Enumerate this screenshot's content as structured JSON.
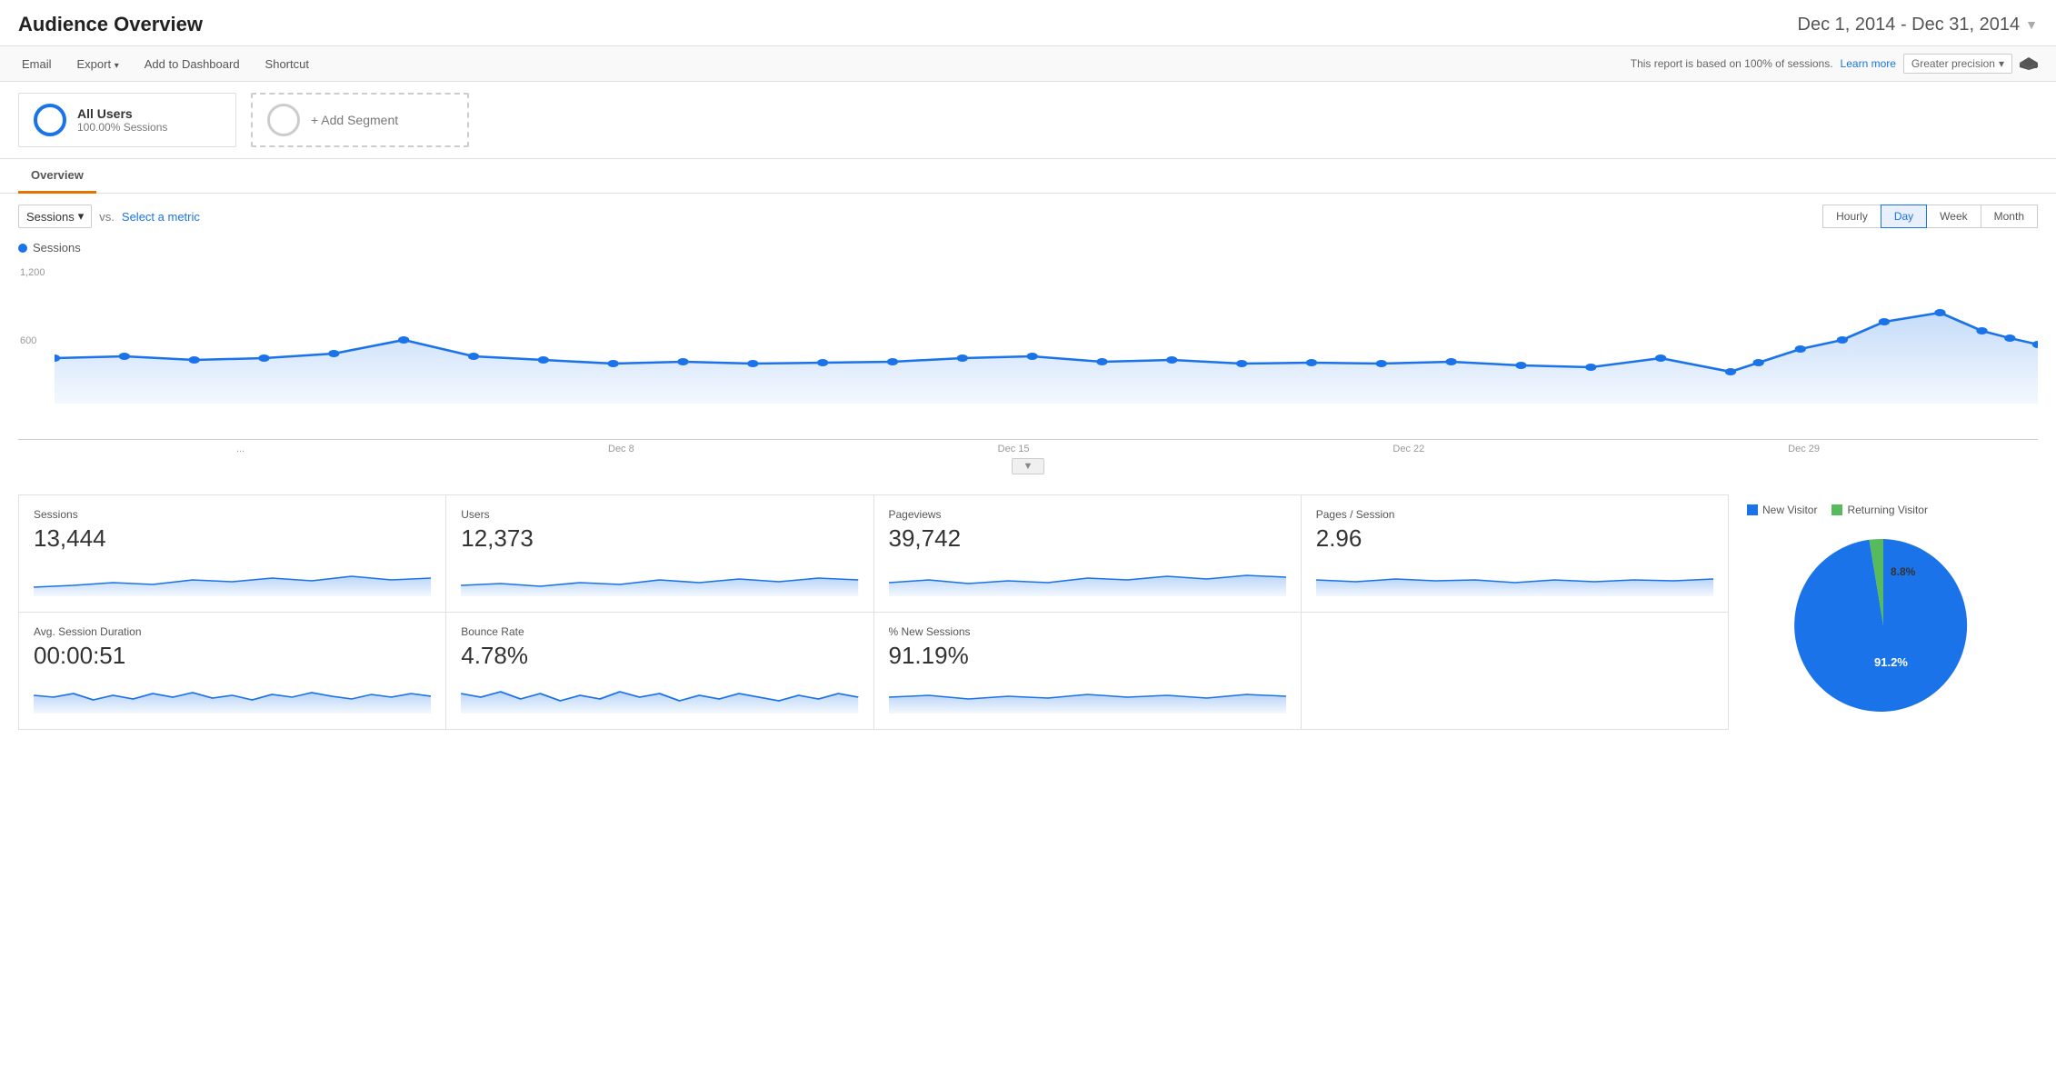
{
  "header": {
    "title": "Audience Overview",
    "date_range": "Dec 1, 2014 - Dec 31, 2014"
  },
  "toolbar": {
    "email": "Email",
    "export": "Export",
    "add_dashboard": "Add to Dashboard",
    "shortcut": "Shortcut",
    "report_info": "This report is based on 100% of sessions.",
    "learn_more": "Learn more",
    "precision": "Greater precision"
  },
  "segments": {
    "all_users": {
      "name": "All Users",
      "sub": "100.00% Sessions"
    },
    "add": "+ Add Segment"
  },
  "overview_tab": "Overview",
  "chart_controls": {
    "metric": "Sessions",
    "vs": "vs.",
    "select_metric": "Select a metric",
    "time_buttons": [
      "Hourly",
      "Day",
      "Week",
      "Month"
    ],
    "active_time": "Day"
  },
  "chart": {
    "legend": "Sessions",
    "y_labels": [
      "1,200",
      "600"
    ],
    "x_labels": [
      "...",
      "Dec 8",
      "Dec 15",
      "Dec 22",
      "Dec 29"
    ]
  },
  "metrics": [
    {
      "label": "Sessions",
      "value": "13,444"
    },
    {
      "label": "Users",
      "value": "12,373"
    },
    {
      "label": "Pageviews",
      "value": "39,742"
    },
    {
      "label": "Pages / Session",
      "value": "2.96"
    },
    {
      "label": "Avg. Session Duration",
      "value": "00:00:51"
    },
    {
      "label": "Bounce Rate",
      "value": "4.78%"
    },
    {
      "label": "% New Sessions",
      "value": "91.19%"
    }
  ],
  "pie": {
    "legend": [
      {
        "label": "New Visitor",
        "color": "#1a73e8"
      },
      {
        "label": "Returning Visitor",
        "color": "#57bb5e"
      }
    ],
    "new_pct": "91.2%",
    "returning_pct": "8.8%",
    "new_value": 91.2,
    "returning_value": 8.8
  }
}
